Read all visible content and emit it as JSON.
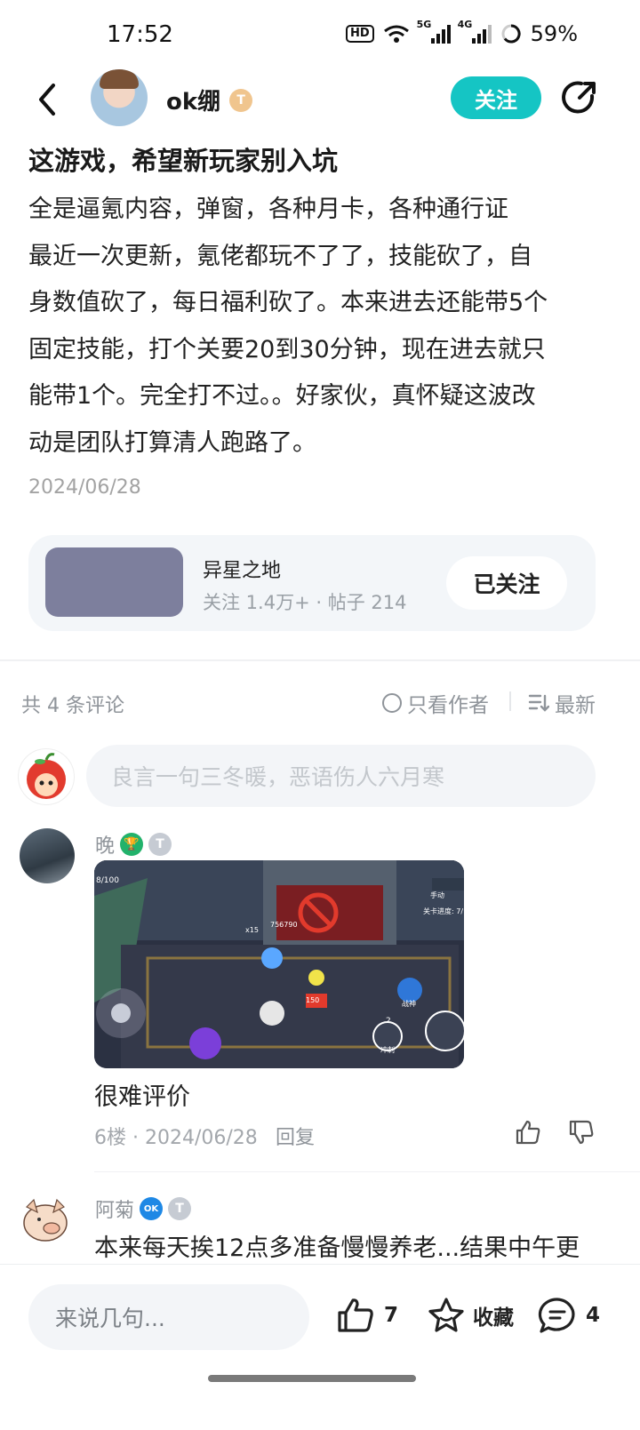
{
  "status_bar": {
    "time": "17:52",
    "hd": "HD",
    "net1": "5G",
    "net2": "4G",
    "battery": "59%"
  },
  "header": {
    "username": "ok绷",
    "user_level": "T",
    "follow_label": "关注"
  },
  "post": {
    "title": "这游戏，希望新玩家别入坑",
    "lines": [
      "全是逼氪内容，弹窗，各种月卡，各种通行证",
      "最近一次更新，氪佬都玩不了了，技能砍了，自",
      "身数值砍了，每日福利砍了。本来进去还能带5个",
      "固定技能，打个关要20到30分钟，现在进去就只",
      "能带1个。完全打不过。。好家伙，真怀疑这波改",
      "动是团队打算清人跑路了。"
    ],
    "date": "2024/06/28"
  },
  "circle": {
    "name": "异星之地",
    "stats": "关注 1.4万+ · 帖子 214",
    "button": "已关注"
  },
  "comments_header": {
    "count": "共 4 条评论",
    "author_only": "只看作者",
    "sort": "最新"
  },
  "comment_input": {
    "placeholder": "良言一句三冬暖，恶语伤人六月寒"
  },
  "comments": [
    {
      "name": "晚",
      "level": "T",
      "text": "很难评价",
      "meta": "6楼 · 2024/06/28",
      "reply": "回复",
      "hud": {
        "hp": "8/100",
        "score": "756790",
        "lives": "x15",
        "dmg": "150",
        "mode": "手动",
        "stage": "关卡进度: 7/",
        "skill1": "冲刺",
        "skill2": "战神",
        "skill_count": "2"
      }
    },
    {
      "name": "阿菊",
      "badge": "OK",
      "level": "T",
      "text": "本来每天挨12点多准备慢慢养老...结果中午更"
    }
  ],
  "bottom_bar": {
    "input_placeholder": "来说几句...",
    "likes": "7",
    "favorite": "收藏",
    "comments": "4"
  },
  "colors": {
    "accent": "#15c5c4",
    "circle_thumb": "#7d7f9d",
    "muted": "#8f949a"
  }
}
